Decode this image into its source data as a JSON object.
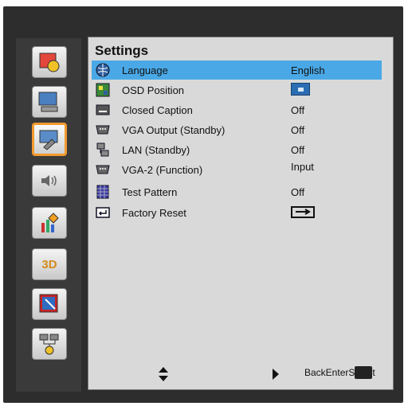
{
  "title": "Settings",
  "sidebar": {
    "items": [
      {
        "name": "image-settings-icon"
      },
      {
        "name": "display-settings-icon"
      },
      {
        "name": "setup-settings-icon"
      },
      {
        "name": "volume-settings-icon"
      },
      {
        "name": "options-settings-icon"
      },
      {
        "name": "3d-settings-icon",
        "label": "3D"
      },
      {
        "name": "interactive-settings-icon"
      },
      {
        "name": "network-settings-icon"
      }
    ]
  },
  "menu": {
    "rows": [
      {
        "label": "Language",
        "value": "English"
      },
      {
        "label": "OSD Position",
        "value": ""
      },
      {
        "label": "Closed Caption",
        "value": "Off"
      },
      {
        "label": "VGA Output (Standby)",
        "value": "Off"
      },
      {
        "label": "LAN (Standby)",
        "value": "Off"
      },
      {
        "label": "VGA-2 (Function)",
        "value": "Input"
      },
      {
        "label": "Test Pattern",
        "value": "Off"
      },
      {
        "label": "Factory Reset",
        "value": ""
      }
    ]
  },
  "footer": {
    "hint": "BackEnterSelect"
  },
  "colors": {
    "selection": "#4aa8e6",
    "accent": "#f29a2e"
  }
}
